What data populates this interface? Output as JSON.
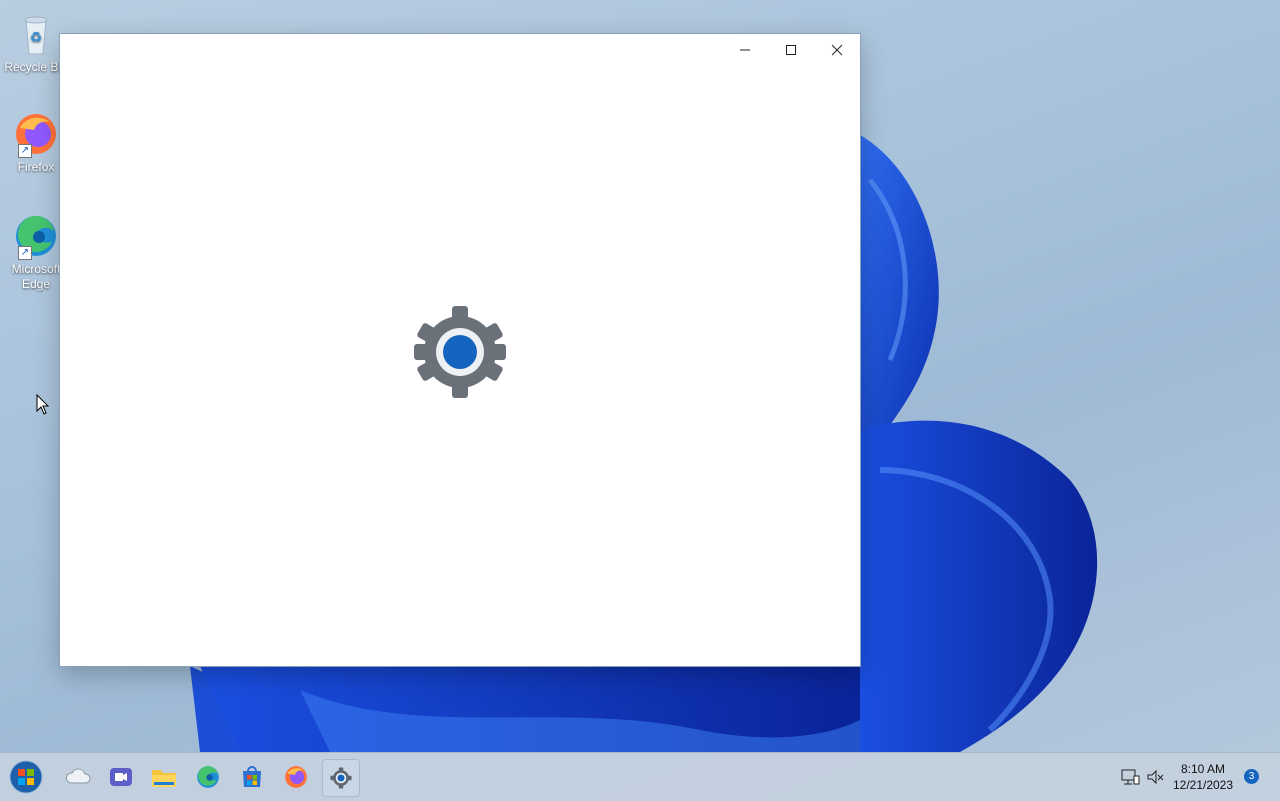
{
  "desktop": {
    "icons": [
      {
        "label": "Recycle Bin",
        "icon": "recycle-bin-icon"
      },
      {
        "label": "Firefox",
        "icon": "firefox-icon"
      },
      {
        "label": "Microsoft Edge",
        "icon": "edge-icon"
      }
    ]
  },
  "window": {
    "minimize_icon": "minimize-icon",
    "maximize_icon": "maximize-icon",
    "close_icon": "close-icon",
    "splash_icon": "settings-gear-icon",
    "colors": {
      "gear_gray": "#6b7178",
      "gear_blue": "#1565c0"
    }
  },
  "taskbar": {
    "items": [
      {
        "name": "start",
        "icon": "windows-start-orb-icon"
      },
      {
        "name": "onedrive",
        "icon": "cloud-icon"
      },
      {
        "name": "teams",
        "icon": "video-chat-icon"
      },
      {
        "name": "file-explorer",
        "icon": "folder-icon"
      },
      {
        "name": "edge",
        "icon": "edge-icon"
      },
      {
        "name": "microsoft-store",
        "icon": "store-icon"
      },
      {
        "name": "firefox",
        "icon": "firefox-icon"
      },
      {
        "name": "settings",
        "icon": "settings-icon",
        "active": true
      }
    ],
    "tray": {
      "network_icon": "network-icon",
      "volume_icon": "volume-muted-icon",
      "time": "8:10 AM",
      "date": "12/21/2023",
      "notification_count": "3"
    }
  }
}
